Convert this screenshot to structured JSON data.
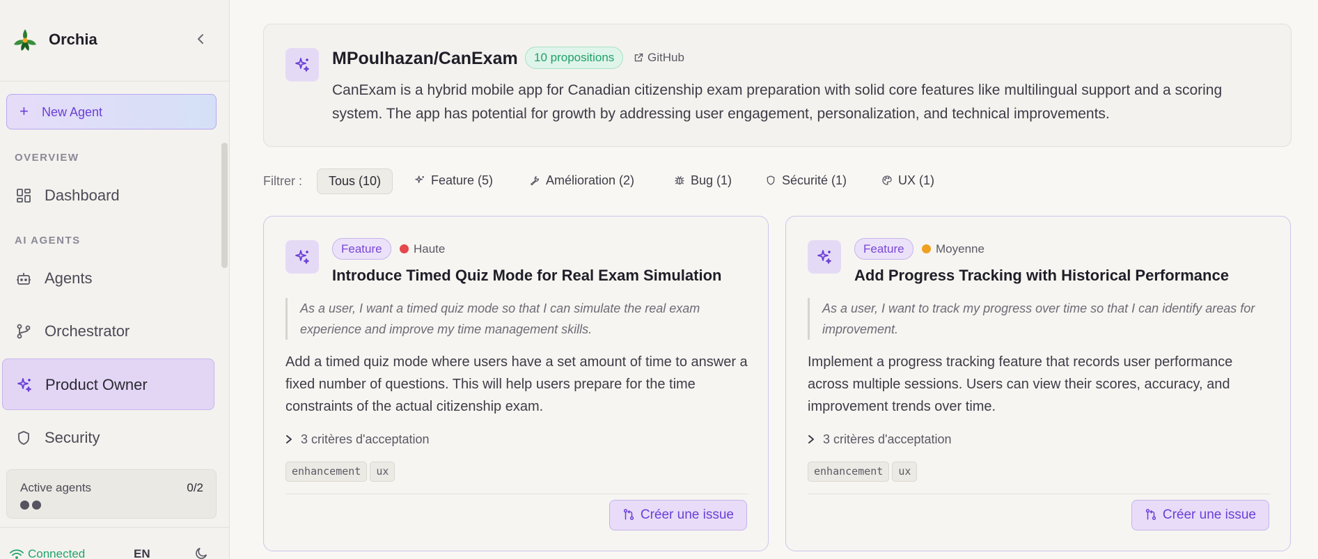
{
  "app": {
    "name": "Orchia"
  },
  "sidebar": {
    "new_agent_label": "New Agent",
    "sections": {
      "overview": "OVERVIEW",
      "ai_agents": "AI AGENTS"
    },
    "items": [
      {
        "label": "Dashboard",
        "icon": "dashboard-icon"
      },
      {
        "label": "Agents",
        "icon": "bot-icon"
      },
      {
        "label": "Orchestrator",
        "icon": "branch-icon"
      },
      {
        "label": "Product Owner",
        "icon": "sparkles-icon",
        "active": true
      },
      {
        "label": "Security",
        "icon": "shield-icon"
      }
    ],
    "active_agents": {
      "label": "Active agents",
      "count": "0/2"
    },
    "footer": {
      "status": "Connected",
      "language": "EN"
    }
  },
  "repo": {
    "title": "MPoulhazan/CanExam",
    "propositions": "10 propositions",
    "github_label": "GitHub",
    "description": "CanExam is a hybrid mobile app for Canadian citizenship exam preparation with solid core features like multilingual support and a scoring system. The app has potential for growth by addressing user engagement, personalization, and technical improvements."
  },
  "filters": {
    "label": "Filtrer :",
    "items": [
      {
        "label": "Tous (10)",
        "active": true
      },
      {
        "label": "Feature (5)",
        "icon": "sparkles-icon"
      },
      {
        "label": "Amélioration (2)",
        "icon": "wrench-icon"
      },
      {
        "label": "Bug (1)",
        "icon": "bug-icon"
      },
      {
        "label": "Sécurité (1)",
        "icon": "shield-icon"
      },
      {
        "label": "UX (1)",
        "icon": "palette-icon"
      }
    ]
  },
  "cards": [
    {
      "type": "Feature",
      "priority": "Haute",
      "priority_color": "#e5484d",
      "title": "Introduce Timed Quiz Mode for Real Exam Simulation",
      "story": "As a user, I want a timed quiz mode so that I can simulate the real exam experience and improve my time management skills.",
      "body": "Add a timed quiz mode where users have a set amount of time to answer a fixed number of questions. This will help users prepare for the time constraints of the actual citizenship exam.",
      "criteria": "3 critères d'acceptation",
      "tags": [
        "enhancement",
        "ux"
      ],
      "action": "Créer une issue"
    },
    {
      "type": "Feature",
      "priority": "Moyenne",
      "priority_color": "#f0a020",
      "title": "Add Progress Tracking with Historical Performance",
      "story": "As a user, I want to track my progress over time so that I can identify areas for improvement.",
      "body": "Implement a progress tracking feature that records user performance across multiple sessions. Users can view their scores, accuracy, and improvement trends over time.",
      "criteria": "3 critères d'acceptation",
      "tags": [
        "enhancement",
        "ux"
      ],
      "action": "Créer une issue"
    }
  ],
  "colors": {
    "accent": "#6a3fd8",
    "success": "#21a069",
    "active_bg": "#e3d6f5"
  }
}
